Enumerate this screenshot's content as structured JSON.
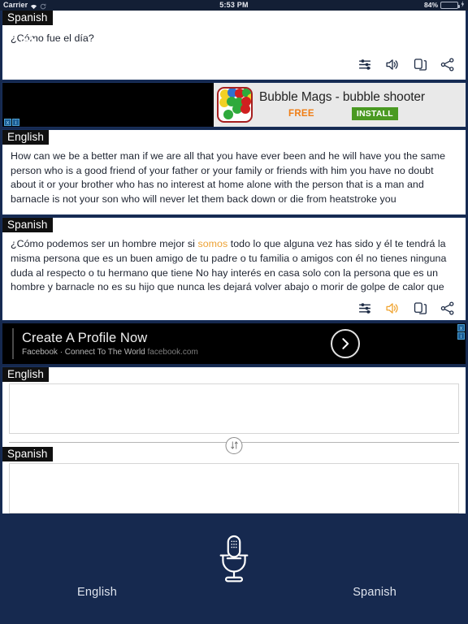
{
  "statusbar": {
    "carrier": "Carrier",
    "wifi_icon": "wifi-icon",
    "sync_icon": "sync-icon",
    "time": "5:53 PM",
    "battery_pct": "84%",
    "battery_icon": "battery-icon",
    "charging_icon": "charging-bolt-icon"
  },
  "cards": {
    "first": {
      "lang_label": "Spanish",
      "text": "¿Cómo fue el día?",
      "icons": [
        "sliders-icon",
        "speaker-icon",
        "copy-icon",
        "share-icon"
      ]
    },
    "english": {
      "lang_label": "English",
      "text": "How can we be a better man if we are all that you have ever been and he will have you the same person who is a good friend of your father or your family or friends with him you have no doubt about it or your brother who has no interest at home alone with the person that is a man and barnacle is not your son who will never let them back down or die from heatstroke you"
    },
    "spanish": {
      "lang_label": "Spanish",
      "text_before": "¿Cómo podemos ser un hombre mejor si ",
      "highlight": "somos",
      "text_after": " todo lo que alguna vez has sido y él te tendrá la misma persona que es un buen amigo de tu padre o tu familia o amigos con él no tienes ninguna duda al respecto o tu hermano que tiene No hay interés en casa solo con la persona que es un hombre y barnacle no es su hijo que nunca les dejará volver abajo o morir de golpe de calor que",
      "icons": [
        "sliders-icon",
        "speaker-icon",
        "copy-icon",
        "share-icon"
      ]
    }
  },
  "ads": {
    "house": {
      "title": "Bubble Mags - bubble shooter",
      "price": "FREE",
      "cta": "INSTALL",
      "close_label": "x",
      "info_label": "i",
      "app_icon": "bubble-shooter-app-icon"
    },
    "facebook": {
      "title": "Create A Profile Now",
      "subtitle": "Facebook · Connect To The World ",
      "subtitle_url": "facebook.com",
      "arrow_icon": "chevron-right-icon",
      "close_label": "x",
      "info_label": "i"
    }
  },
  "input_area": {
    "english_label": "English",
    "english_value": "",
    "english_placeholder": "",
    "spanish_label": "Spanish",
    "spanish_value": "",
    "spanish_placeholder": "",
    "swap_icon": "swap-vertical-icon"
  },
  "bottombar": {
    "left_lang": "English",
    "right_lang": "Spanish",
    "mic_icon": "microphone-icon"
  },
  "colors": {
    "accent_orange": "#f3ae42",
    "highlight_orange": "#eda235",
    "navy_bg": "#16294f",
    "dark_navy": "#131f35",
    "install_green": "#4a9a22",
    "free_orange": "#f07e16",
    "battery_green": "#4cd562"
  }
}
